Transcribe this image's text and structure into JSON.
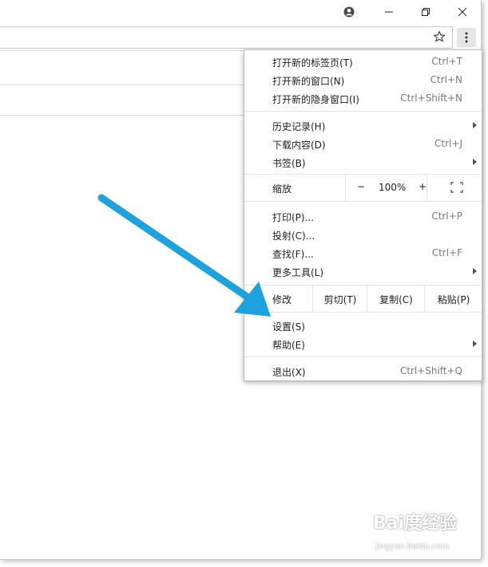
{
  "colors": {
    "arrow": "#1ea1dc",
    "menu_border": "#bdbdbd",
    "shortcut": "#7a7a7a"
  },
  "titlebar": {
    "icons": [
      "account-icon",
      "minimize-icon",
      "restore-icon",
      "close-icon"
    ]
  },
  "toolbar": {
    "icons": [
      "bookmark-star-icon",
      "kebab-menu-icon"
    ]
  },
  "menu": {
    "new_tab": {
      "label": "打开新的标签页(T)",
      "shortcut": "Ctrl+T"
    },
    "new_window": {
      "label": "打开新的窗口(N)",
      "shortcut": "Ctrl+N"
    },
    "new_incognito": {
      "label": "打开新的隐身窗口(I)",
      "shortcut": "Ctrl+Shift+N"
    },
    "history": {
      "label": "历史记录(H)"
    },
    "downloads": {
      "label": "下载内容(D)",
      "shortcut": "Ctrl+J"
    },
    "bookmarks": {
      "label": "书签(B)"
    },
    "zoom": {
      "label": "缩放",
      "minus": "−",
      "value": "100%",
      "plus": "+"
    },
    "print": {
      "label": "打印(P)...",
      "shortcut": "Ctrl+P"
    },
    "cast": {
      "label": "投射(C)..."
    },
    "find": {
      "label": "查找(F)...",
      "shortcut": "Ctrl+F"
    },
    "more_tools": {
      "label": "更多工具(L)"
    },
    "edit": {
      "label": "修改",
      "cut": "剪切(T)",
      "copy": "复制(C)",
      "paste": "粘贴(P)"
    },
    "settings": {
      "label": "设置(S)"
    },
    "help": {
      "label": "帮助(E)"
    },
    "exit": {
      "label": "退出(X)",
      "shortcut": "Ctrl+Shift+Q"
    }
  },
  "watermark": {
    "logo_text": "Bai度经验",
    "url": "jingyan.baidu.com"
  }
}
